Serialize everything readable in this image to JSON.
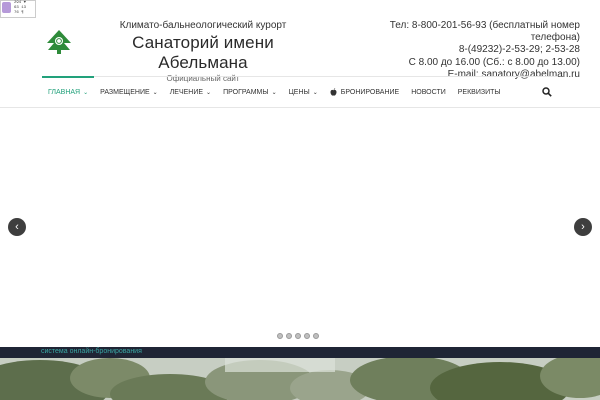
{
  "counter": {
    "lines": [
      "294 ▼",
      "63 13",
      "76 ¶"
    ],
    "icon": "counter-icon"
  },
  "header": {
    "tagline": "Климато-бальнеологический курорт",
    "title": "Санаторий имени Абельмана",
    "subtitle": "Официальный сайт",
    "logo_icon": "fir-tree-logo-icon"
  },
  "contacts": {
    "phone_line1": "Тел: 8-800-201-56-93 (бесплатный номер",
    "phone_line2": "телефона)",
    "phone_local": "8-(49232)-2-53-29; 2-53-28",
    "hours": "С 8.00 до 16.00 (Сб.: с 8.00 до 13.00)",
    "email": "E-mail: sanatory@abelman.ru"
  },
  "nav": {
    "items": [
      {
        "label": "ГЛАВНАЯ",
        "dropdown": true,
        "active": true
      },
      {
        "label": "РАЗМЕЩЕНИЕ",
        "dropdown": true
      },
      {
        "label": "ЛЕЧЕНИЕ",
        "dropdown": true
      },
      {
        "label": "ПРОГРАММЫ",
        "dropdown": true
      },
      {
        "label": "ЦЕНЫ",
        "dropdown": true
      },
      {
        "label": "БРОНИРОВАНИЕ",
        "icon": "apple-icon"
      },
      {
        "label": "НОВОСТИ"
      },
      {
        "label": "РЕКВИЗИТЫ"
      }
    ],
    "search_icon": "search-icon",
    "accent_color": "#22a17b"
  },
  "slider": {
    "prev_icon": "chevron-left-icon",
    "next_icon": "chevron-right-icon",
    "prev_glyph": "‹",
    "next_glyph": "›",
    "dots_count": 5
  },
  "booking": {
    "link_text": "система онлайн-бронирования",
    "bar_color": "#1f2535",
    "link_color": "#3aa6a3"
  }
}
